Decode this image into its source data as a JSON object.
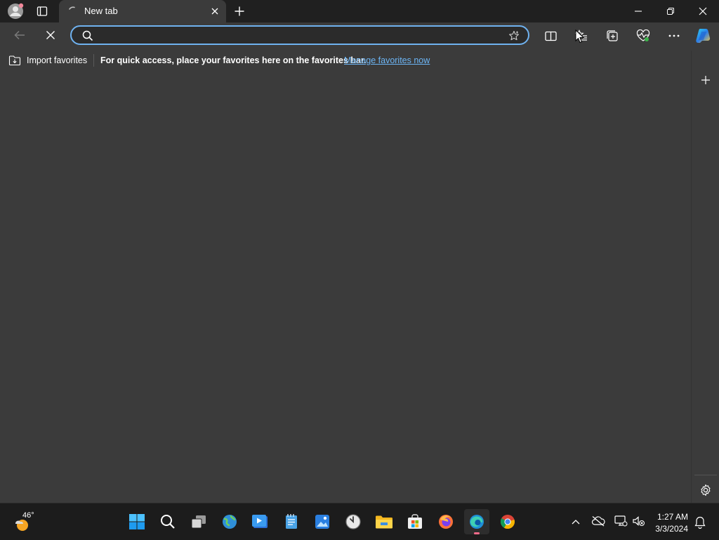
{
  "browser": {
    "tab": {
      "title": "New tab"
    },
    "address_bar": {
      "value": "",
      "placeholder": ""
    },
    "favorites_bar": {
      "import_label": "Import favorites",
      "prompt": "For quick access, place your favorites here on the favorites bar.",
      "manage_link": "Manage favorites now"
    }
  },
  "taskbar": {
    "weather": {
      "temp": "46°"
    },
    "clock": {
      "time": "1:27 AM",
      "date": "3/3/2024"
    }
  },
  "colors": {
    "accent": "#6fb2f0",
    "link": "#6cb5f5",
    "page_bg": "#3b3b3b",
    "titlebar_bg": "#202020",
    "taskbar_bg": "#1c1c1c"
  },
  "icons": {
    "titlebar": [
      "profile-avatar-icon",
      "tab-actions-icon",
      "new-tab-icon",
      "minimize-icon",
      "restore-icon",
      "close-window-icon"
    ],
    "toolbar": [
      "back-icon",
      "stop-loading-icon",
      "search-icon",
      "favorite-star-icon",
      "split-screen-icon",
      "favorites-icon",
      "collections-icon",
      "browser-essentials-icon",
      "more-icon",
      "copilot-icon"
    ],
    "taskbar": [
      "windows-start-icon",
      "taskbar-search-icon",
      "task-view-icon",
      "weather-app-icon",
      "media-player-icon",
      "notepad-icon",
      "photos-icon",
      "clock-icon",
      "file-explorer-icon",
      "microsoft-store-icon",
      "firefox-icon",
      "edge-icon",
      "chrome-icon"
    ]
  }
}
